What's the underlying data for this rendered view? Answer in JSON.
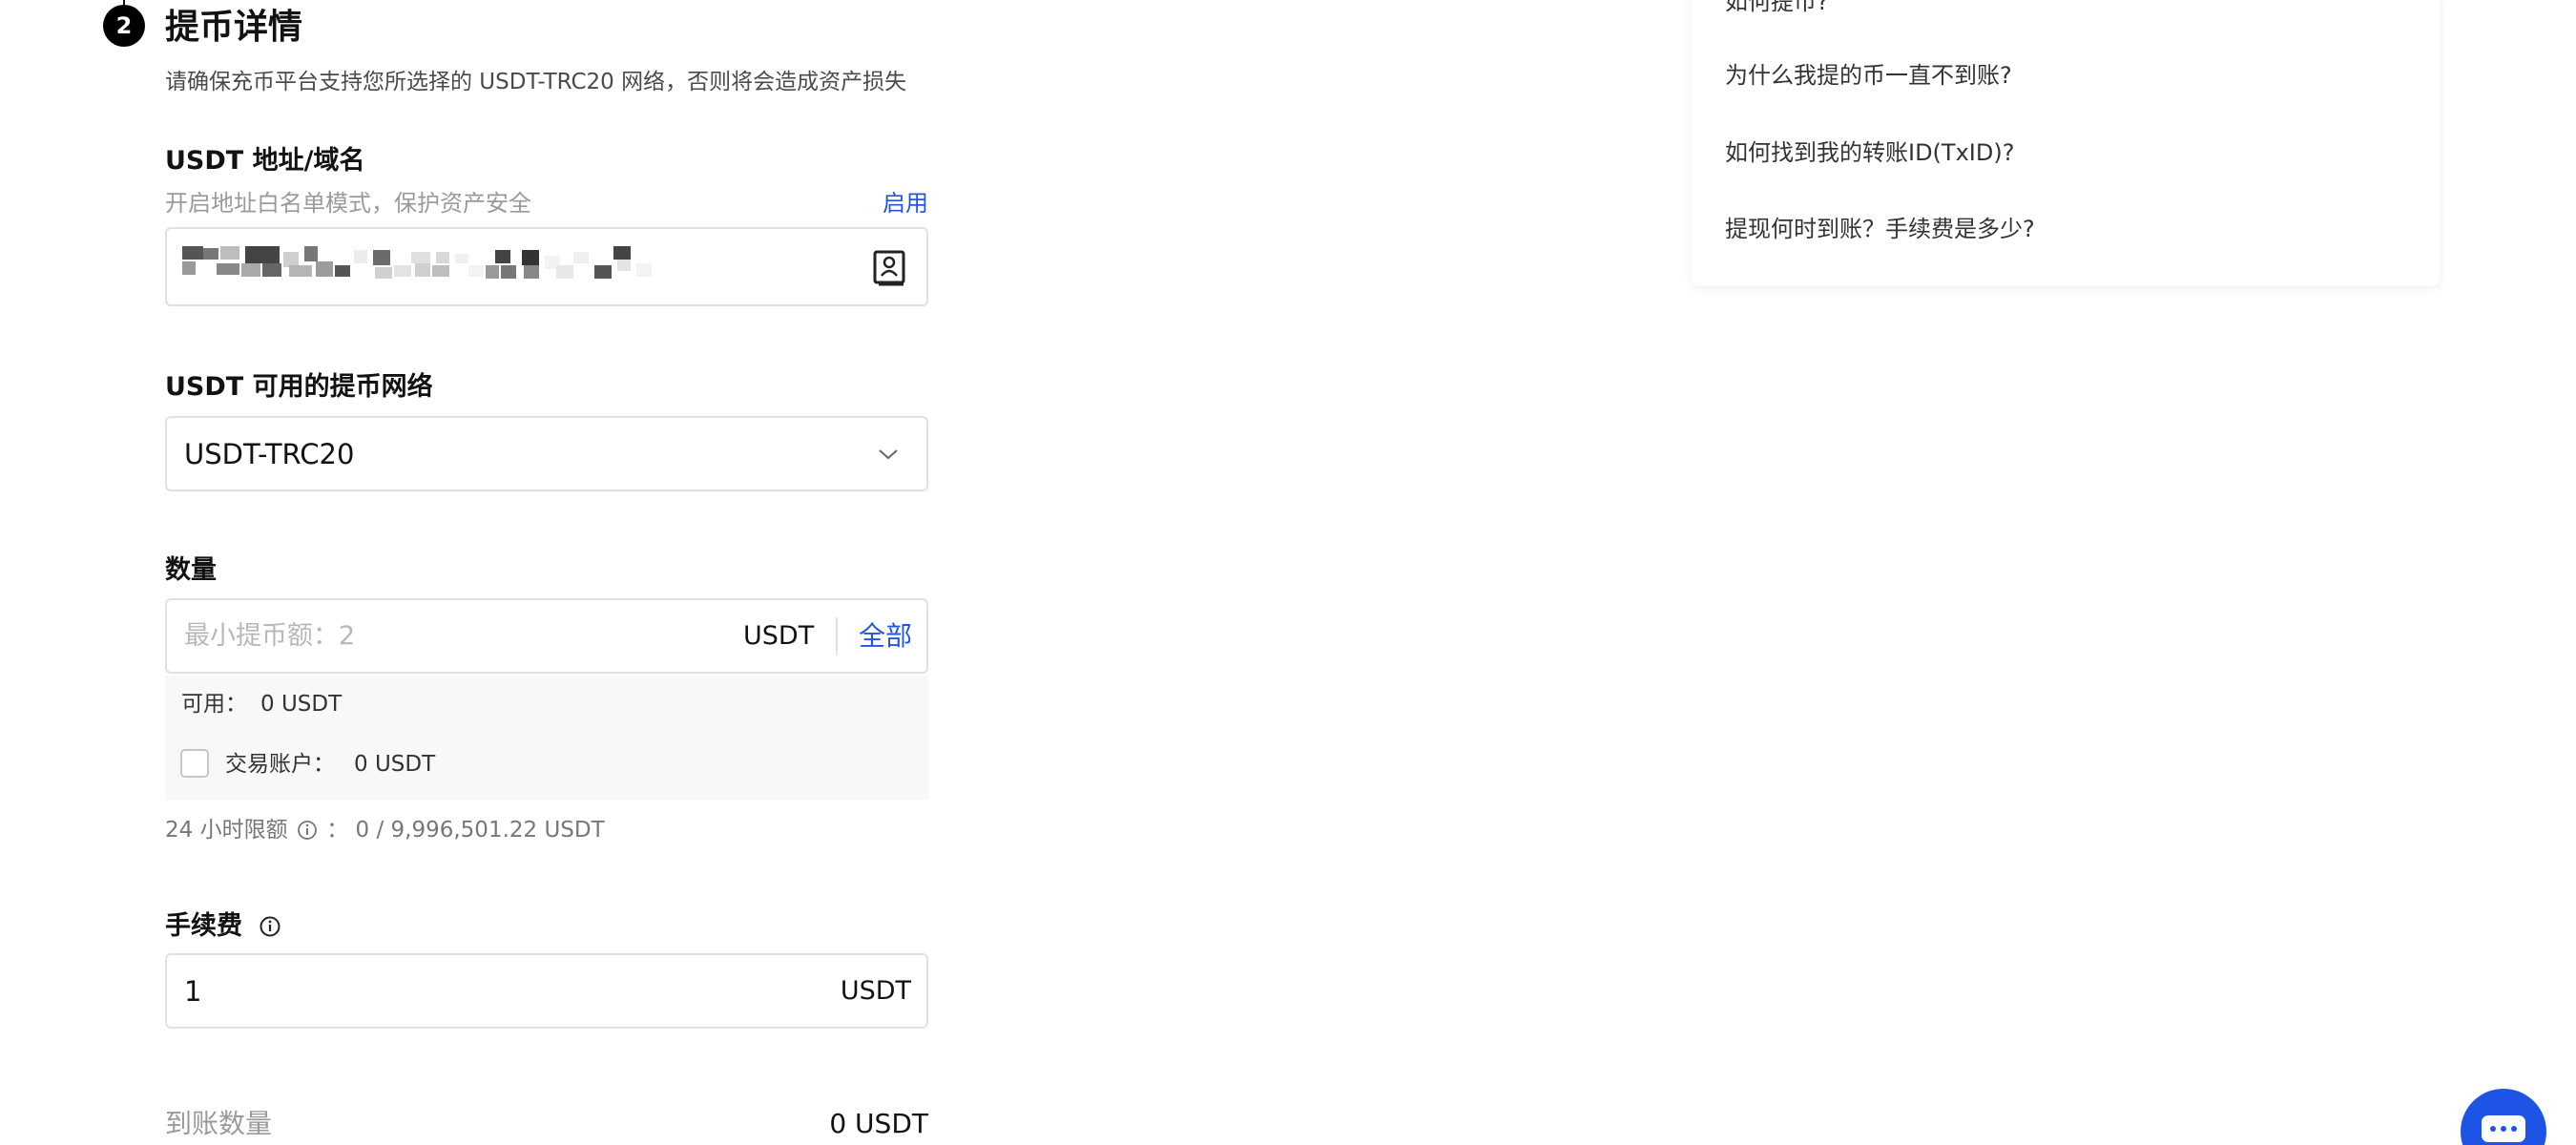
{
  "step": {
    "number": "2",
    "title": "提币详情",
    "description": "请确保充币平台支持您所选择的 USDT-TRC20 网络，否则将会造成资产损失"
  },
  "address": {
    "label": "USDT 地址/域名",
    "whitelist_hint": "开启地址白名单模式，保护资产安全",
    "enable_link": "启用"
  },
  "network": {
    "label": "USDT 可用的提币网络",
    "selected": "USDT-TRC20"
  },
  "amount": {
    "label": "数量",
    "placeholder": "最小提币额：2",
    "unit": "USDT",
    "all_button": "全部",
    "available_label": "可用：",
    "available_value": "0 USDT",
    "trading_account_label": "交易账户：",
    "trading_account_value": "0 USDT",
    "limit_label": "24 小时限额",
    "limit_value": "： 0 / 9,996,501.22 USDT"
  },
  "fee": {
    "label": "手续费",
    "value": "1",
    "unit": "USDT"
  },
  "receive": {
    "label": "到账数量",
    "value": "0 USDT"
  },
  "faq": {
    "items": [
      "如何提币?",
      "为什么我提的币一直不到账?",
      "如何找到我的转账ID(TxID)?",
      "提现何时到账？手续费是多少?"
    ]
  },
  "colors": {
    "accent": "#2354e6",
    "chat": "#1d54e5"
  }
}
